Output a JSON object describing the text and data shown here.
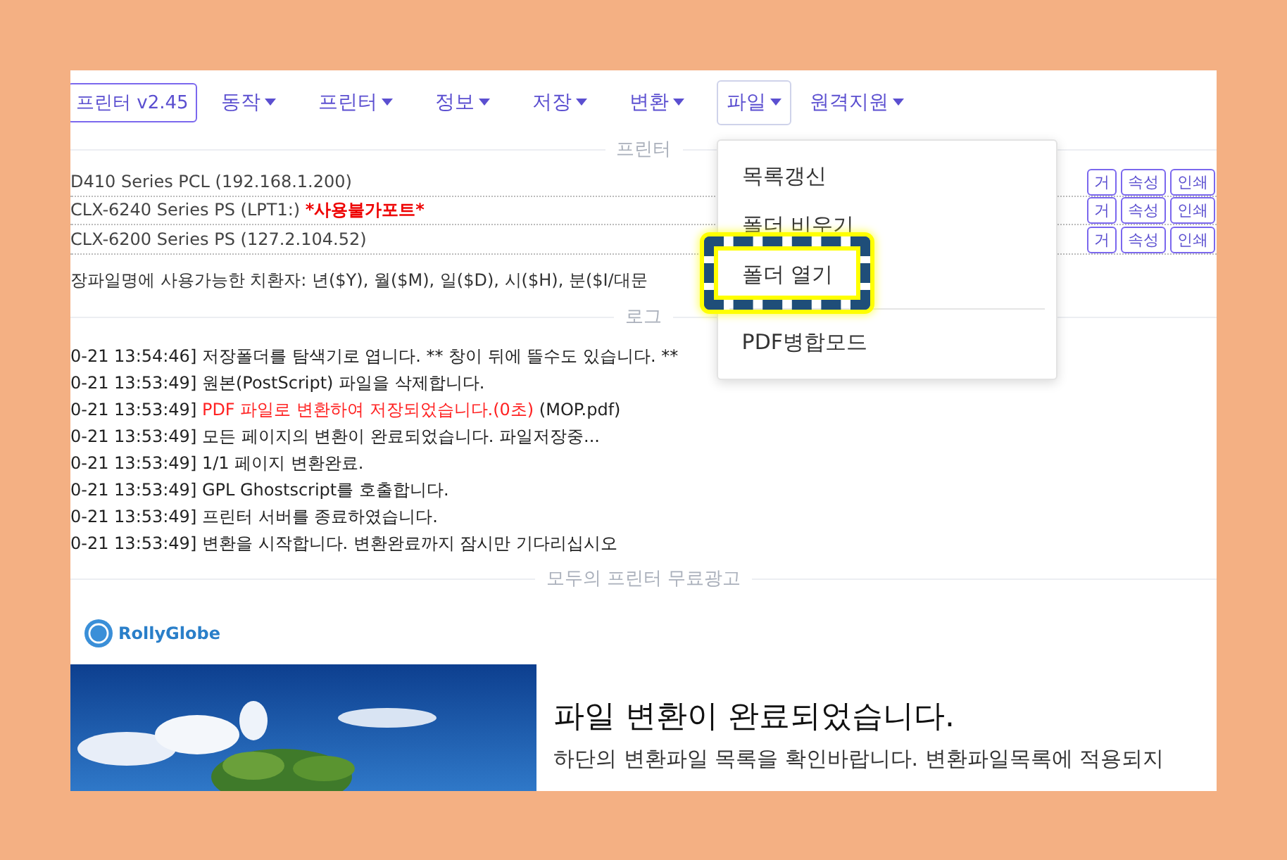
{
  "nav": {
    "brand": "프린터 v2.45",
    "menus": [
      {
        "label": "동작",
        "selected": false
      },
      {
        "label": "프린터",
        "selected": false
      },
      {
        "label": "정보",
        "selected": false
      },
      {
        "label": "저장",
        "selected": false
      },
      {
        "label": "변환",
        "selected": false
      },
      {
        "label": "파일",
        "selected": true
      },
      {
        "label": "원격지원",
        "selected": false
      }
    ]
  },
  "dropdown": {
    "items": [
      {
        "kind": "item",
        "label": "목록갱신",
        "highlighted": false
      },
      {
        "kind": "item",
        "label": "폴더 비우기",
        "highlighted": false
      },
      {
        "kind": "item",
        "label": "폴더 열기",
        "highlighted": true
      },
      {
        "kind": "divider"
      },
      {
        "kind": "item",
        "label": "PDF병합모드",
        "highlighted": false
      }
    ]
  },
  "printer_section": {
    "title": "프린터",
    "printers": [
      {
        "name": "D410 Series PCL (192.168.1.200)",
        "buttons": [
          "거",
          "속성",
          "인쇄"
        ]
      },
      {
        "name": "CLX-6240 Series PS (LPT1:)",
        "warning": "*사용불가포트*",
        "buttons": [
          "거",
          "속성",
          "인쇄"
        ]
      },
      {
        "name": "CLX-6200 Series PS (127.2.104.52)",
        "buttons": [
          "거",
          "속성",
          "인쇄"
        ]
      }
    ]
  },
  "substitution_note": "장파일명에 사용가능한 치환자: 년($Y), 월($M), 일($D), 시($H), 분($I/대문",
  "log_section": {
    "title": "로그",
    "entries": [
      {
        "time": "0-21 13:54:46]",
        "message": "저장폴더를 탐색기로 엽니다. ** 창이 뒤에 뜰수도 있습니다. **"
      },
      {
        "time": "0-21 13:53:49]",
        "message": "원본(PostScript) 파일을 삭제합니다."
      },
      {
        "time": "0-21 13:53:49]",
        "alert": "PDF 파일로 변환하여 저장되었습니다.(0초)",
        "message": "(MOP.pdf)"
      },
      {
        "time": "0-21 13:53:49]",
        "message": "모든 페이지의 변환이 완료되었습니다. 파일저장중..."
      },
      {
        "time": "0-21 13:53:49]",
        "message": "1/1 페이지 변환완료."
      },
      {
        "time": "0-21 13:53:49]",
        "message": "GPL Ghostscript를 호출합니다."
      },
      {
        "time": "0-21 13:53:49]",
        "message": "프린터 서버를 종료하였습니다."
      },
      {
        "time": "0-21 13:53:49]",
        "message": "변환을 시작합니다. 변환완료까지 잠시만 기다리십시오"
      }
    ]
  },
  "ad": {
    "title": "모두의 프린터 무료광고",
    "brand": "RollyGlobe",
    "heading": "파일 변환이 완료되었습니다.",
    "body": "하단의 변환파일 목록을 확인바랍니다. 변환파일목록에 적용되지"
  }
}
